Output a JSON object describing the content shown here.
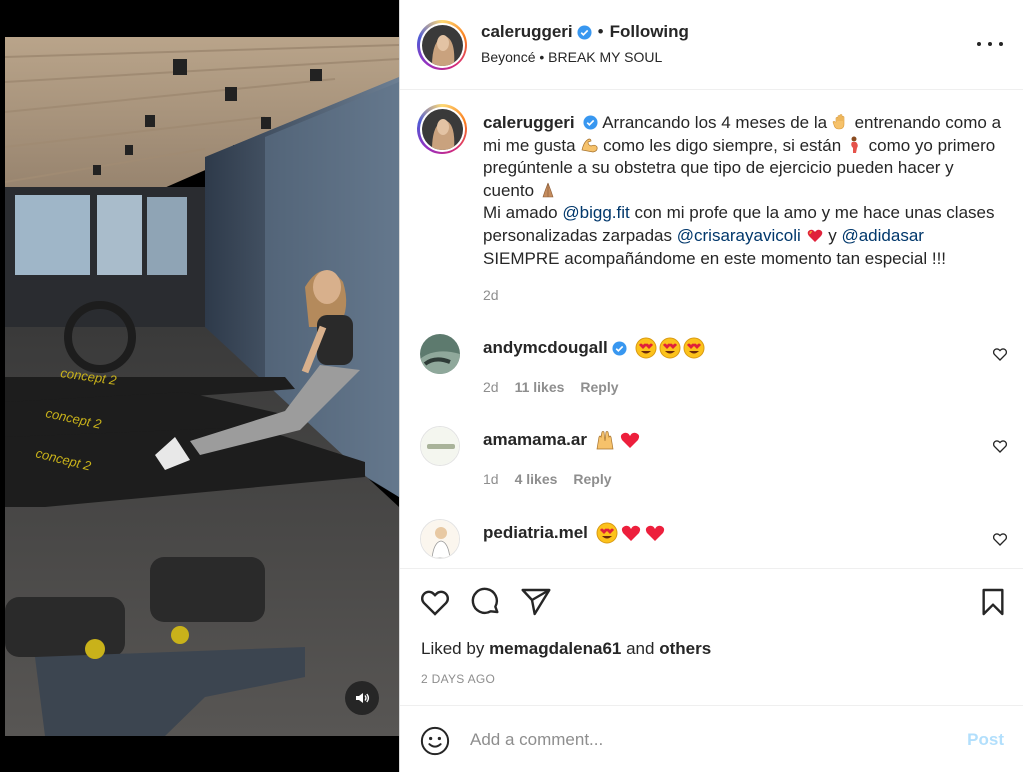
{
  "header": {
    "username": "caleruggeri",
    "separator": "•",
    "follow_state": "Following",
    "audio_artist": "Beyoncé",
    "audio_track": "BREAK MY SOUL",
    "icons": {
      "verified": "verified-badge-icon",
      "more": "more-options-icon"
    }
  },
  "caption": {
    "username": "caleruggeri",
    "seg1": "Arrancando los 4 meses de la",
    "seg2": "entrenando como a mi me gusta",
    "seg3": "como les digo siempre, si están",
    "seg4": "como yo primero pregúntenle a su obstetra que tipo de ejercicio pueden hacer y cuento",
    "seg5": "Mi amado",
    "mention1": "@bigg.fit",
    "seg6": "con mi profe que la amo y me hace unas clases personalizadas zarpadas",
    "mention2": "@crisarayavicoli",
    "seg7": "y",
    "mention3": "@adidasar",
    "seg8": "SIEMPRE acompañándome en este momento tan especial !!!",
    "age": "2d"
  },
  "comments": [
    {
      "username": "andymcdougall",
      "verified": true,
      "age": "2d",
      "likes": "11 likes",
      "reply": "Reply"
    },
    {
      "username": "amamama.ar",
      "verified": false,
      "age": "1d",
      "likes": "4 likes",
      "reply": "Reply"
    },
    {
      "username": "pediatria.mel",
      "verified": false
    }
  ],
  "liked_by": {
    "prefix": "Liked by",
    "user": "memagdalena61",
    "middle": "and",
    "others": "others"
  },
  "post_date": "2 DAYS AGO",
  "composer": {
    "placeholder": "Add a comment...",
    "post_label": "Post"
  },
  "colors": {
    "link": "#00376b",
    "muted": "#8e8e8e",
    "post_disabled": "#b2dffc",
    "verified": "#3897f0",
    "heart": "#ed1f3c"
  }
}
